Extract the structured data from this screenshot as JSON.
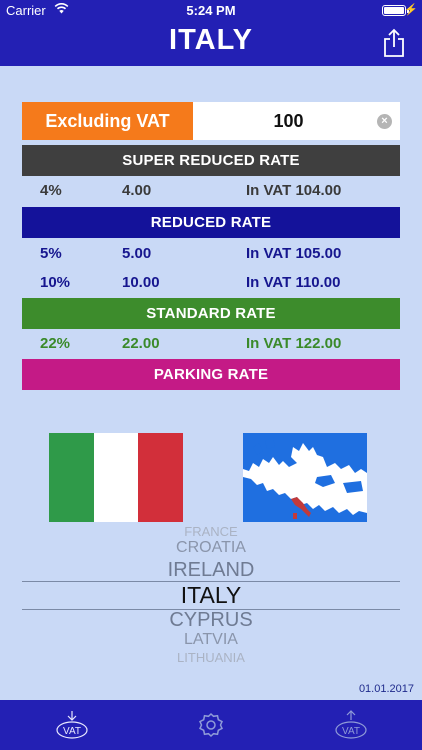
{
  "status": {
    "carrier": "Carrier",
    "time": "5:24 PM"
  },
  "header": {
    "title": "ITALY"
  },
  "input": {
    "mode_label": "Excluding VAT",
    "value": "100"
  },
  "rates": {
    "super_reduced": {
      "label": "SUPER REDUCED RATE",
      "color": "#3f3f3f",
      "text_color": "#3a3a3a",
      "rows": [
        {
          "pct": "4%",
          "amount": "4.00",
          "in_vat": "In VAT 104.00"
        }
      ]
    },
    "reduced": {
      "label": "REDUCED RATE",
      "color": "#14129a",
      "text_color": "#16168f",
      "rows": [
        {
          "pct": "5%",
          "amount": "5.00",
          "in_vat": "In VAT 105.00"
        },
        {
          "pct": "10%",
          "amount": "10.00",
          "in_vat": "In VAT 110.00"
        }
      ]
    },
    "standard": {
      "label": "STANDARD RATE",
      "color": "#3d8c2c",
      "text_color": "#3a8a2a",
      "rows": [
        {
          "pct": "22%",
          "amount": "22.00",
          "in_vat": "In VAT 122.00"
        }
      ]
    },
    "parking": {
      "label": "PARKING RATE",
      "color": "#c41a86"
    }
  },
  "picker": {
    "items": [
      "FRANCE",
      "CROATIA",
      "IRELAND",
      "ITALY",
      "CYPRUS",
      "LATVIA",
      "LITHUANIA"
    ],
    "selected": "ITALY"
  },
  "date": "01.01.2017",
  "tabs": {
    "vat_in": "VAT",
    "vat_out": "VAT"
  },
  "colors": {
    "header": "#2320b4",
    "background": "#c9d9f6",
    "accent_orange": "#f57a1b"
  }
}
